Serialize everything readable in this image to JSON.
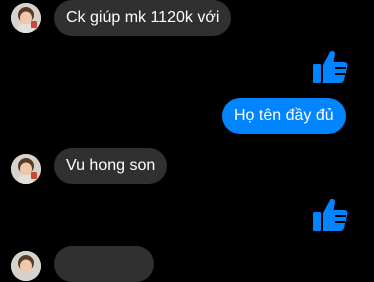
{
  "messages": [
    {
      "direction": "in",
      "text": "Ck giúp mk 1120k với"
    },
    {
      "direction": "out",
      "icon": "thumbs-up-icon"
    },
    {
      "direction": "out",
      "text": "Họ tên đầy đủ"
    },
    {
      "direction": "in",
      "text": "Vu hong son"
    },
    {
      "direction": "out",
      "icon": "thumbs-up-icon"
    },
    {
      "direction": "in",
      "text": ""
    }
  ],
  "colors": {
    "background": "#000000",
    "incoming_bubble": "#303030",
    "outgoing_bubble": "#0084ff",
    "like": "#0084ff"
  }
}
